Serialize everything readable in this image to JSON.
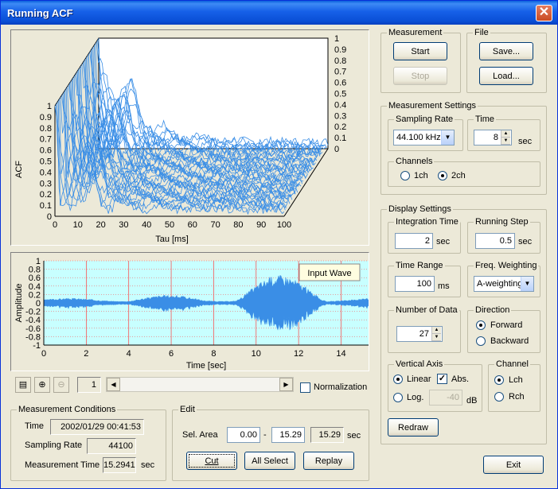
{
  "window": {
    "title": "Running ACF",
    "close": "✕"
  },
  "acf_chart": {
    "ylabel": "ACF",
    "xlabel": "Tau [ms]",
    "x_ticks": [
      "0",
      "10",
      "20",
      "30",
      "40",
      "50",
      "60",
      "70",
      "80",
      "90",
      "100"
    ],
    "y_ticks": [
      "0",
      "0.1",
      "0.2",
      "0.3",
      "0.4",
      "0.5",
      "0.6",
      "0.7",
      "0.8",
      "0.9",
      "1"
    ],
    "color": "#3a8ee6"
  },
  "wave_chart": {
    "ylabel": "Amplitude",
    "xlabel": "Time [sec]",
    "legend": "Input Wave",
    "x_ticks": [
      "0",
      "2",
      "4",
      "6",
      "8",
      "10",
      "12",
      "14"
    ],
    "y_ticks": [
      "1",
      "0.8",
      "0.6",
      "0.4",
      "0.2",
      "0",
      "-0.2",
      "-0.4",
      "-0.6",
      "-0.8",
      "-1"
    ],
    "background": "#c8ffff",
    "color": "#3a8ee6"
  },
  "toolbar": {
    "page_value": "1",
    "normalization_label": "Normalization",
    "normalization_checked": false
  },
  "measurement": {
    "legend": "Measurement",
    "start": "Start",
    "stop": "Stop"
  },
  "file": {
    "legend": "File",
    "save": "Save...",
    "load": "Load..."
  },
  "measurement_settings": {
    "legend": "Measurement Settings",
    "sampling_rate_legend": "Sampling Rate",
    "sampling_rate_value": "44.100 kHz",
    "time_legend": "Time",
    "time_value": "8",
    "time_unit": "sec",
    "channels_legend": "Channels",
    "ch1": "1ch",
    "ch2": "2ch"
  },
  "display_settings": {
    "legend": "Display Settings",
    "integration_time_legend": "Integration Time",
    "integration_time_value": "2",
    "integration_time_unit": "sec",
    "running_step_legend": "Running Step",
    "running_step_value": "0.5",
    "running_step_unit": "sec",
    "time_range_legend": "Time Range",
    "time_range_value": "100",
    "time_range_unit": "ms",
    "freq_weighting_legend": "Freq. Weighting",
    "freq_weighting_value": "A-weighting",
    "number_of_data_legend": "Number of Data",
    "number_of_data_value": "27",
    "direction_legend": "Direction",
    "forward": "Forward",
    "backward": "Backward",
    "vertical_axis_legend": "Vertical Axis",
    "linear": "Linear",
    "abs": "Abs.",
    "log": "Log.",
    "log_value": "-40",
    "log_unit": "dB",
    "channel_legend": "Channel",
    "lch": "Lch",
    "rch": "Rch",
    "redraw": "Redraw"
  },
  "conditions": {
    "legend": "Measurement Conditions",
    "time_label": "Time",
    "time_value": "2002/01/29 00:41:53",
    "sampling_rate_label": "Sampling Rate",
    "sampling_rate_value": "44100",
    "measurement_time_label": "Measurement Time",
    "measurement_time_value": "15.2941",
    "measurement_time_unit": "sec"
  },
  "edit": {
    "legend": "Edit",
    "sel_area_label": "Sel. Area",
    "from": "0.00",
    "dash": "-",
    "to": "15.29",
    "length": "15.29",
    "unit": "sec",
    "cut": "Cut",
    "all_select": "All Select",
    "replay": "Replay"
  },
  "exit": "Exit"
}
